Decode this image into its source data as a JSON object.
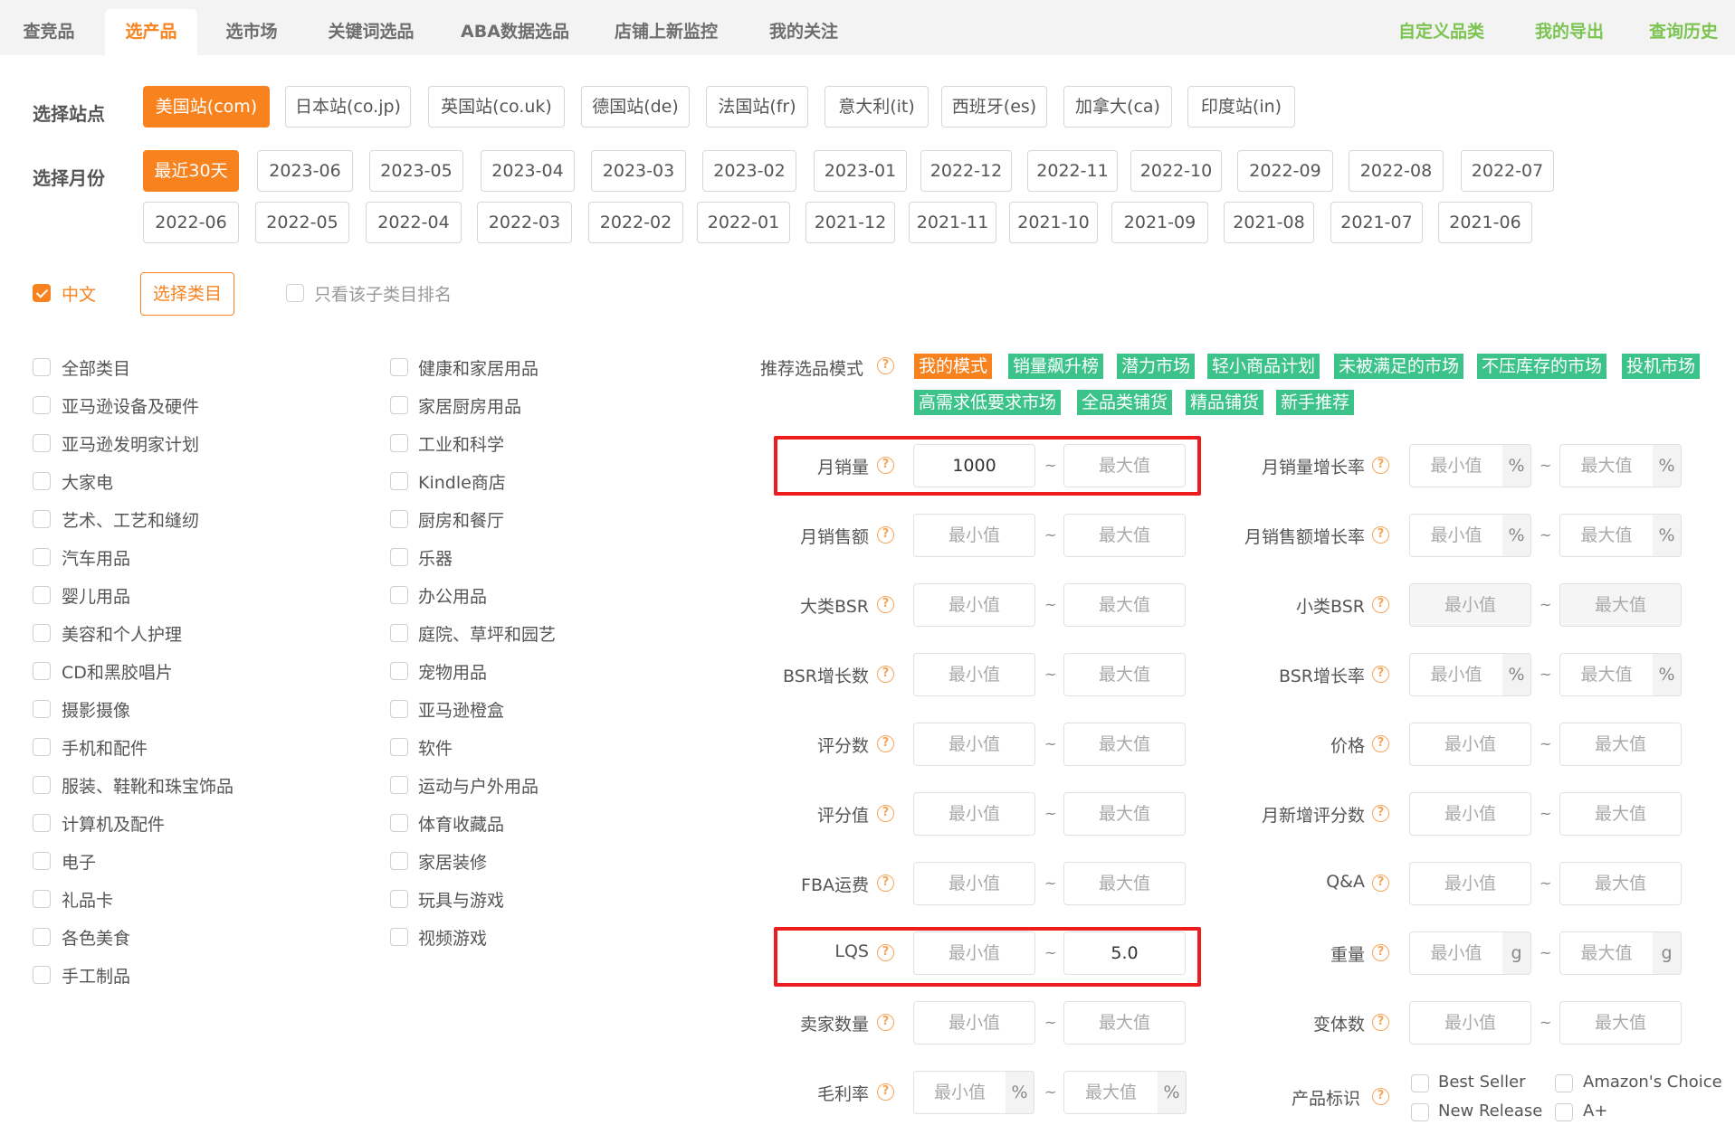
{
  "nav": {
    "tabs": [
      "查竞品",
      "选产品",
      "选市场",
      "关键词选品",
      "ABA数据选品",
      "店铺上新监控",
      "我的关注"
    ],
    "right_links": [
      "自定义品类",
      "我的导出",
      "查询历史"
    ]
  },
  "site": {
    "label": "选择站点",
    "options": [
      "美国站(com)",
      "日本站(co.jp)",
      "英国站(co.uk)",
      "德国站(de)",
      "法国站(fr)",
      "意大利(it)",
      "西班牙(es)",
      "加拿大(ca)",
      "印度站(in)"
    ],
    "selected": "美国站(com)"
  },
  "month": {
    "label": "选择月份",
    "row1": [
      "最近30天",
      "2023-06",
      "2023-05",
      "2023-04",
      "2023-03",
      "2023-02",
      "2023-01",
      "2022-12",
      "2022-11",
      "2022-10",
      "2022-09",
      "2022-08",
      "2022-07"
    ],
    "row2": [
      "2022-06",
      "2022-05",
      "2022-04",
      "2022-03",
      "2022-02",
      "2022-01",
      "2021-12",
      "2021-11",
      "2021-10",
      "2021-09",
      "2021-08",
      "2021-07",
      "2021-06"
    ],
    "selected": "最近30天"
  },
  "options": {
    "chinese_label": "中文",
    "chinese_checked": true,
    "select_category_button": "选择类目",
    "only_sub_category_label": "只看该子类目排名"
  },
  "categories": {
    "col1": [
      "全部类目",
      "亚马逊设备及硬件",
      "亚马逊发明家计划",
      "大家电",
      "艺术、工艺和缝纫",
      "汽车用品",
      "婴儿用品",
      "美容和个人护理",
      "CD和黑胶唱片",
      "摄影摄像",
      "手机和配件",
      "服装、鞋靴和珠宝饰品",
      "计算机及配件",
      "电子",
      "礼品卡",
      "各色美食",
      "手工制品"
    ],
    "col2": [
      "健康和家居用品",
      "家居厨房用品",
      "工业和科学",
      "Kindle商店",
      "厨房和餐厅",
      "乐器",
      "办公用品",
      "庭院、草坪和园艺",
      "宠物用品",
      "亚马逊橙盒",
      "软件",
      "运动与户外用品",
      "体育收藏品",
      "家居装修",
      "玩具与游戏",
      "视频游戏"
    ]
  },
  "mode": {
    "label": "推荐选品模式",
    "tags": [
      "我的模式",
      "销量飙升榜",
      "潜力市场",
      "轻小商品计划",
      "未被满足的市场",
      "不压库存的市场",
      "投机市场",
      "高需求低要求市场",
      "全品类铺货",
      "精品铺货",
      "新手推荐"
    ]
  },
  "placeholders": {
    "min": "最小值",
    "max": "最大值"
  },
  "units": {
    "percent": "%",
    "gram": "g"
  },
  "tilde": "~",
  "filters_left": [
    {
      "label": "月销量",
      "min_value": "1000",
      "max_value": ""
    },
    {
      "label": "月销售额",
      "min_value": "",
      "max_value": ""
    },
    {
      "label": "大类BSR",
      "min_value": "",
      "max_value": ""
    },
    {
      "label": "BSR增长数",
      "min_value": "",
      "max_value": ""
    },
    {
      "label": "评分数",
      "min_value": "",
      "max_value": ""
    },
    {
      "label": "评分值",
      "min_value": "",
      "max_value": ""
    },
    {
      "label": "FBA运费",
      "min_value": "",
      "max_value": ""
    },
    {
      "label": "LQS",
      "min_value": "",
      "max_value": "5.0"
    },
    {
      "label": "卖家数量",
      "min_value": "",
      "max_value": ""
    },
    {
      "label": "毛利率",
      "min_value": "",
      "max_value": "",
      "unit": "%"
    }
  ],
  "filters_right": [
    {
      "label": "月销量增长率",
      "unit": "%"
    },
    {
      "label": "月销售额增长率",
      "unit": "%"
    },
    {
      "label": "小类BSR",
      "disabled": true
    },
    {
      "label": "BSR增长率",
      "unit": "%"
    },
    {
      "label": "价格"
    },
    {
      "label": "月新增评分数"
    },
    {
      "label": "Q&A"
    },
    {
      "label": "重量",
      "unit": "g"
    },
    {
      "label": "变体数"
    }
  ],
  "product_badge": {
    "label": "产品标识",
    "options": [
      "Best Seller",
      "Amazon's Choice",
      "New Release",
      "A+"
    ]
  },
  "colors": {
    "accent": "#f7821e",
    "green_link": "#7cc451",
    "green_tag": "#3cc38a",
    "highlight": "#ee1c1c"
  }
}
